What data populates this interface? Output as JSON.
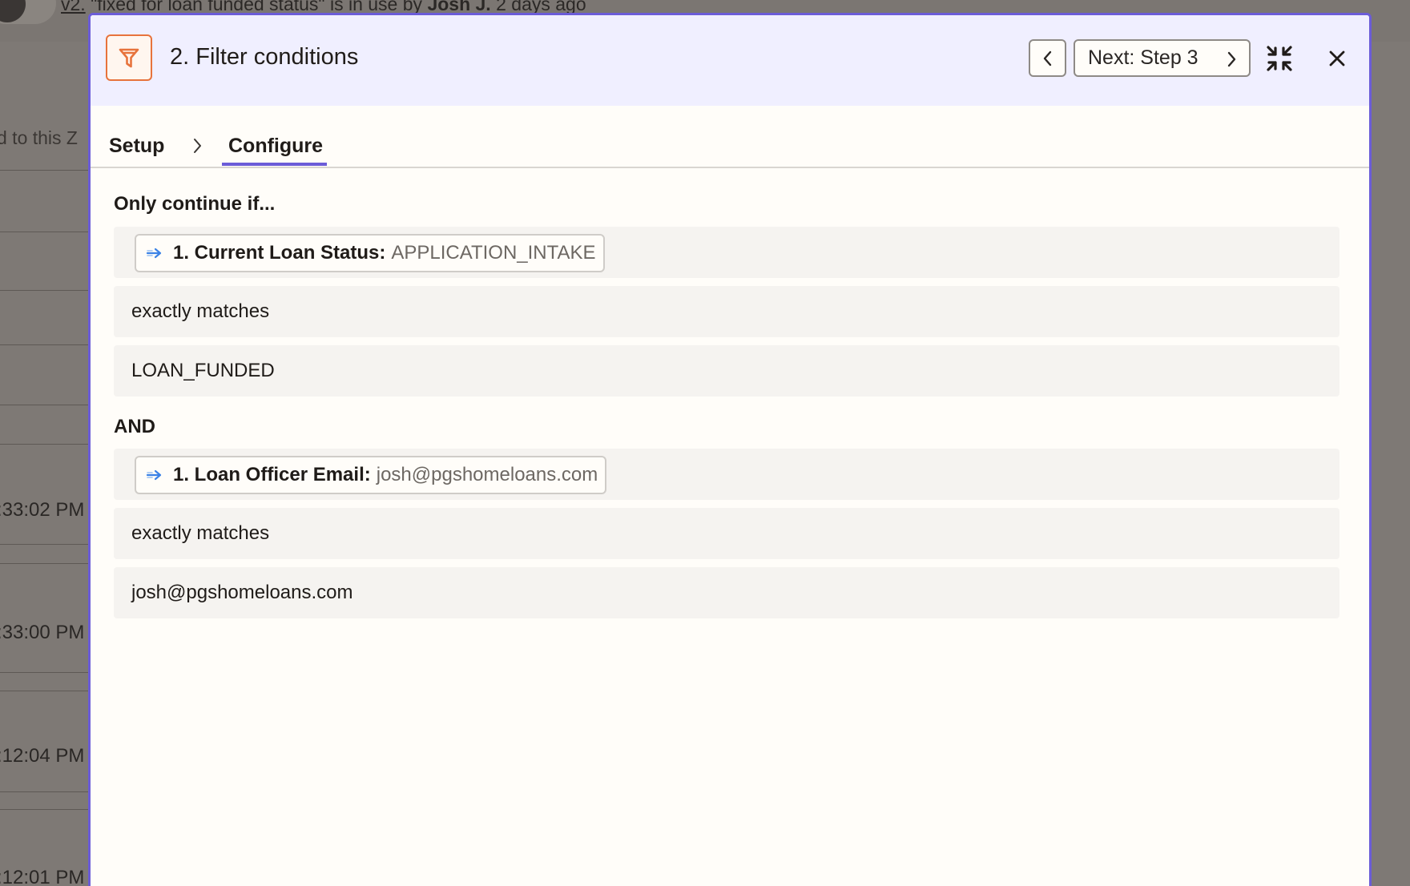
{
  "background": {
    "version_prefix": "v2.",
    "version_text": "\"fixed for loan funded status\" is in use by",
    "version_user": "Josh J.",
    "version_time": "2 days ago",
    "side_text": "d to this Z",
    "times": [
      ":33:02 PM",
      ":33:00 PM",
      ":12:04 PM",
      ":12:01 PM"
    ]
  },
  "modal": {
    "title": "2. Filter conditions",
    "next_label": "Next: Step 3",
    "tabs": {
      "setup": "Setup",
      "configure": "Configure"
    },
    "only_continue_label": "Only continue if...",
    "and_label": "AND",
    "conditions": [
      {
        "field_name": "1. Current Loan Status:",
        "field_value": "APPLICATION_INTAKE",
        "operator": "exactly matches",
        "value": "LOAN_FUNDED"
      },
      {
        "field_name": "1. Loan Officer Email:",
        "field_value": "josh@pgshomeloans.com",
        "operator": "exactly matches",
        "value": "josh@pgshomeloans.com"
      }
    ]
  },
  "colors": {
    "accent": "#6b5cd8",
    "step_icon": "#e7733c",
    "header_bg": "#f0efff",
    "row_bg": "#f5f3f0"
  },
  "icons": [
    "filter-icon",
    "chevron-left-icon",
    "chevron-right-icon",
    "collapse-icon",
    "close-icon",
    "arrow-right-icon"
  ]
}
